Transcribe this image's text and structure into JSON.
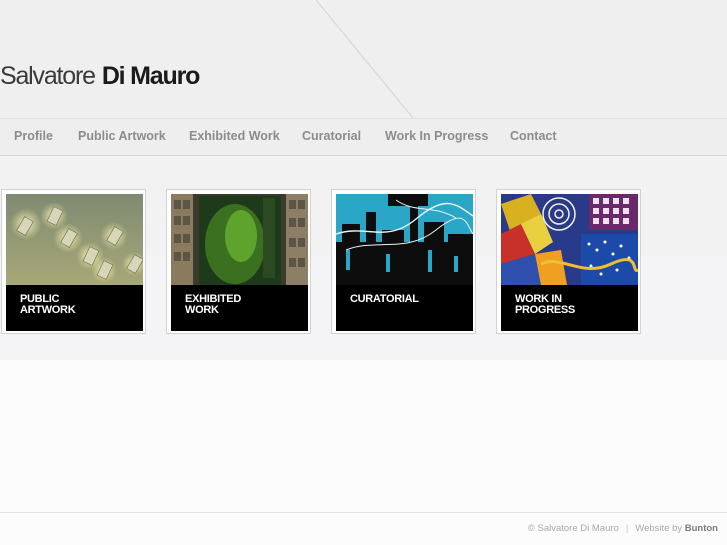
{
  "site": {
    "name_first": "Salvatore",
    "name_last": "Di Mauro"
  },
  "nav": {
    "items": [
      {
        "label": "Profile"
      },
      {
        "label": "Public Artwork"
      },
      {
        "label": "Exhibited Work"
      },
      {
        "label": "Curatorial"
      },
      {
        "label": "Work In Progress"
      },
      {
        "label": "Contact"
      }
    ]
  },
  "tiles": [
    {
      "caption": "PUBLIC\nARTWORK",
      "image": "public-artwork-photo"
    },
    {
      "caption": "EXHIBITED\nWORK",
      "image": "exhibited-work-photo"
    },
    {
      "caption": "CURATORIAL",
      "image": "curatorial-photo"
    },
    {
      "caption": "WORK IN\nPROGRESS",
      "image": "work-in-progress-photo"
    }
  ],
  "footer": {
    "copyright": "© Salvatore Di Mauro",
    "separator": "|",
    "credit_prefix": "Website by",
    "credit_link": "Bunton"
  },
  "colors": {
    "header_bg": "#efefef",
    "nav_text": "#8c8c8c",
    "caption_bg": "#000000",
    "caption_text": "#ffffff"
  }
}
